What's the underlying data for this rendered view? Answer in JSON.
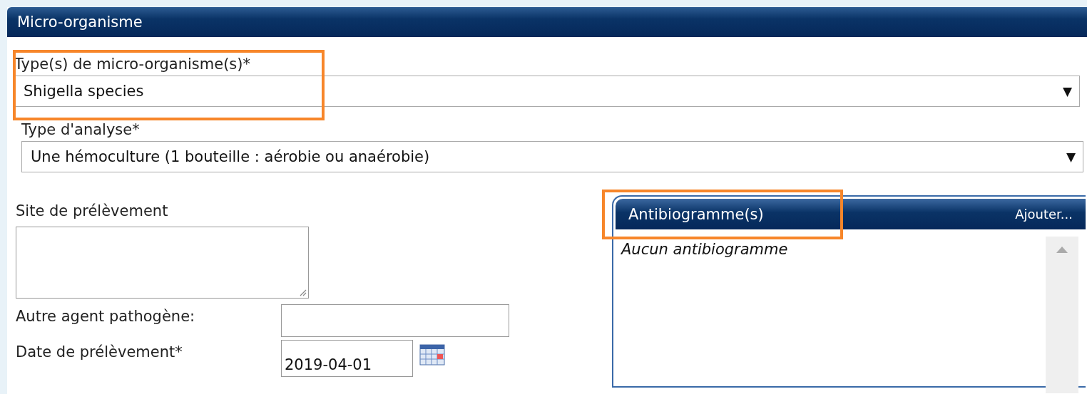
{
  "section": {
    "title": "Micro-organisme"
  },
  "organism_field": {
    "label": "Type(s) de micro-organisme(s)*",
    "value": "Shigella species",
    "arrow": "▼",
    "highlighted": true
  },
  "analysis_field": {
    "label": "Type d'analyse*",
    "value": "Une hémoculture (1 bouteille : aérobie ou anaérobie)",
    "arrow": "▼",
    "highlighted": false
  },
  "site_field": {
    "label": "Site de prélèvement"
  },
  "other_agent_field": {
    "label": "Autre agent pathogène:"
  },
  "date_field": {
    "label": "Date de prélèvement*",
    "value": "2019-04-01"
  },
  "antibiogram_panel": {
    "title": "Antibiogramme(s)",
    "add_link": "Ajouter...",
    "empty_text": "Aucun antibiogramme",
    "highlighted": true
  }
}
